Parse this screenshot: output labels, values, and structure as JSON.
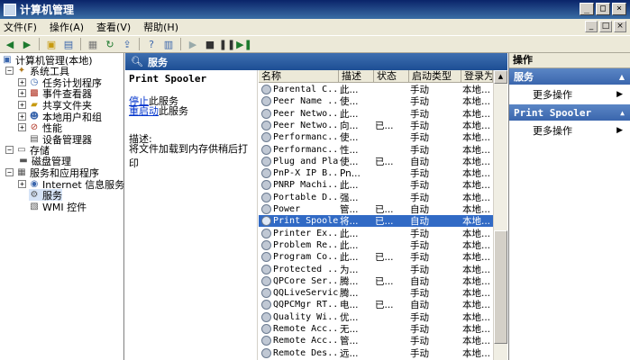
{
  "window": {
    "title": "计算机管理",
    "controls": [
      "_",
      "□",
      "×"
    ]
  },
  "menu": {
    "items": [
      "文件(F)",
      "操作(A)",
      "查看(V)",
      "帮助(H)"
    ],
    "right_controls": [
      "_",
      "□",
      "×"
    ]
  },
  "toolbar": {
    "icons": [
      "back-arrow-icon",
      "forward-arrow-icon",
      "up-folder-icon",
      "show-tree-icon",
      "properties-icon",
      "refresh-icon",
      "export-icon",
      "help-icon",
      "mmc-icon",
      "play-icon",
      "stop-icon",
      "pause-icon",
      "restart-icon"
    ]
  },
  "tree": {
    "root": "计算机管理(本地)",
    "system_tools": "系统工具",
    "task_scheduler": "任务计划程序",
    "event_viewer": "事件查看器",
    "shared_folders": "共享文件夹",
    "local_users": "本地用户和组",
    "performance": "性能",
    "device_manager": "设备管理器",
    "storage": "存储",
    "disk_management": "磁盘管理",
    "services_apps": "服务和应用程序",
    "internet_info": "Internet 信息服务",
    "services": "服务",
    "wmi": "WMI 控件"
  },
  "middle": {
    "header": "服务",
    "selected_service": "Print Spooler",
    "stop_link": "停止",
    "stop_suffix": "此服务",
    "restart_link": "重启动",
    "restart_suffix": "此服务",
    "desc_label": "描述:",
    "desc_text": "将文件加载到内存供稍后打印"
  },
  "list": {
    "columns": [
      "名称",
      "描述",
      "状态",
      "启动类型",
      "登录为"
    ],
    "rows": [
      [
        "Parental C...",
        "此...",
        "",
        "手动",
        "本地..."
      ],
      [
        "Peer Name ...",
        "使...",
        "",
        "手动",
        "本地..."
      ],
      [
        "Peer Netwo...",
        "此...",
        "",
        "手动",
        "本地..."
      ],
      [
        "Peer Netwo...",
        "向...",
        "已...",
        "手动",
        "本地..."
      ],
      [
        "Performanc...",
        "使...",
        "",
        "手动",
        "本地..."
      ],
      [
        "Performanc...",
        "性...",
        "",
        "手动",
        "本地..."
      ],
      [
        "Plug and Play",
        "使...",
        "已...",
        "自动",
        "本地..."
      ],
      [
        "PnP-X IP B...",
        "Pn...",
        "",
        "手动",
        "本地..."
      ],
      [
        "PNRP Machi...",
        "此...",
        "",
        "手动",
        "本地..."
      ],
      [
        "Portable D...",
        "强...",
        "",
        "手动",
        "本地..."
      ],
      [
        "Power",
        "管...",
        "已...",
        "自动",
        "本地..."
      ],
      [
        "Print Spooler",
        "将...",
        "已...",
        "自动",
        "本地..."
      ],
      [
        "Printer Ex...",
        "此...",
        "",
        "手动",
        "本地..."
      ],
      [
        "Problem Re...",
        "此...",
        "",
        "手动",
        "本地..."
      ],
      [
        "Program Co...",
        "此...",
        "已...",
        "手动",
        "本地..."
      ],
      [
        "Protected ...",
        "为...",
        "",
        "手动",
        "本地..."
      ],
      [
        "QPCore Ser...",
        "腾...",
        "已...",
        "自动",
        "本地..."
      ],
      [
        "QQLiveService",
        "腾...",
        "",
        "手动",
        "本地..."
      ],
      [
        "QQPCMgr RT...",
        "电...",
        "已...",
        "自动",
        "本地..."
      ],
      [
        "Quality Wi...",
        "优...",
        "",
        "手动",
        "本地..."
      ],
      [
        "Remote Acc...",
        "无...",
        "",
        "手动",
        "本地..."
      ],
      [
        "Remote Acc...",
        "管...",
        "",
        "手动",
        "本地..."
      ],
      [
        "Remote Des...",
        "远...",
        "",
        "手动",
        "本地..."
      ]
    ],
    "selected_index": 11
  },
  "actions": {
    "header": "操作",
    "section1": "服务",
    "more1": "更多操作",
    "section2": "Print Spooler",
    "more2": "更多操作"
  }
}
